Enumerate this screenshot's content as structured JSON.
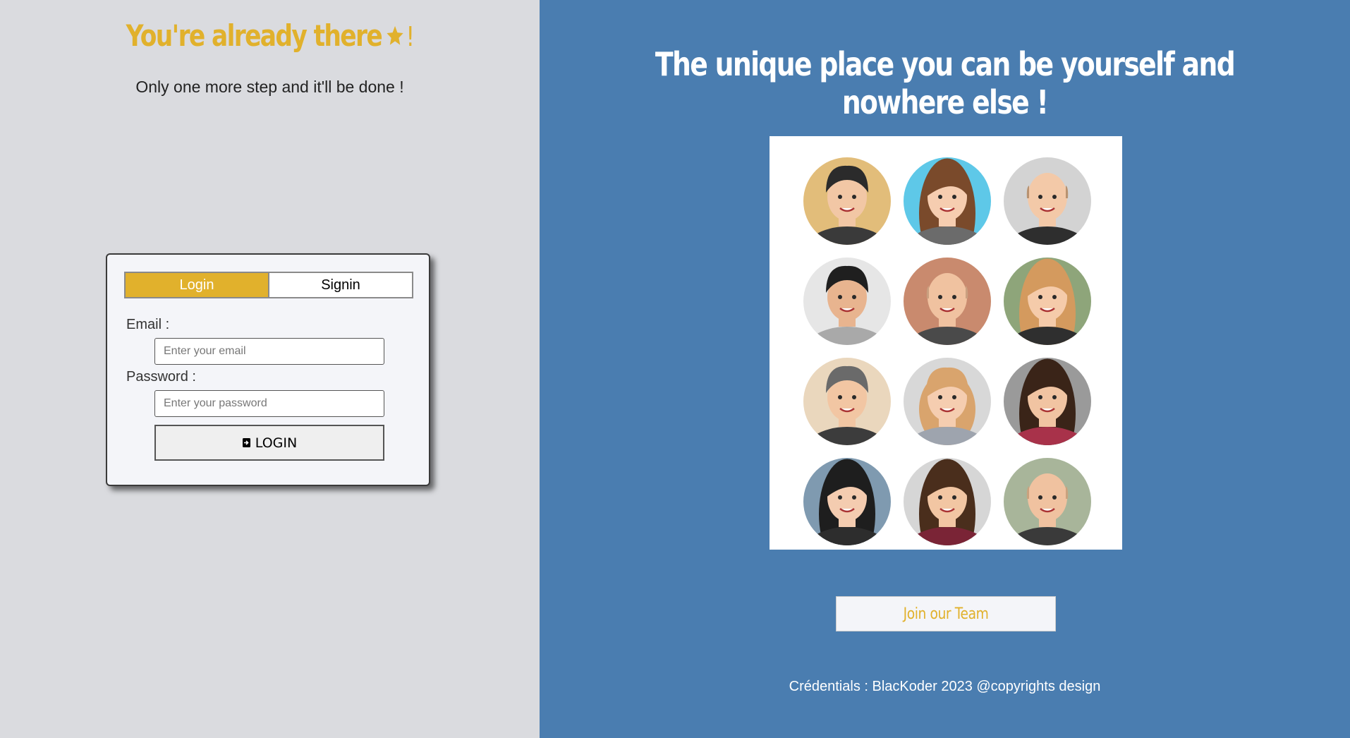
{
  "left": {
    "title": "You're already there",
    "title_excl": "!",
    "subtitle": "Only one more step and it'll be done !"
  },
  "form": {
    "tabs": [
      {
        "label": "Login",
        "active": true
      },
      {
        "label": "Signin",
        "active": false
      }
    ],
    "email_label": "Email :",
    "email_placeholder": "Enter your email",
    "password_label": "Password :",
    "password_placeholder": "Enter your password",
    "submit_label": "LOGIN",
    "submit_icon": "sign-in-icon"
  },
  "right": {
    "title": "The unique place you can be yourself and nowhere else !",
    "image_name": "team-avatars-illustration",
    "join_label": "Join our Team",
    "footer": "Crédentials : BlacKoder 2023 @copyrights design"
  },
  "colors": {
    "accent": "#e1b12c",
    "left_bg": "#dadbdf",
    "right_bg": "#4a7db0",
    "card_bg": "#f4f5f9"
  },
  "avatars": [
    {
      "bg": "#e2bd7a",
      "skin": "#f2c7a5",
      "hair": "#2b2b2b",
      "shirt": "#3a3a3a",
      "style": "short"
    },
    {
      "bg": "#5ec8e8",
      "skin": "#f6cdb0",
      "hair": "#7a4a2b",
      "shirt": "#6b6b6b",
      "style": "long"
    },
    {
      "bg": "#d3d3d3",
      "skin": "#f3c9a8",
      "hair": "#b89270",
      "shirt": "#2e2e2e",
      "style": "bald"
    },
    {
      "bg": "#e6e6e6",
      "skin": "#e8b48f",
      "hair": "#1f1f1f",
      "shirt": "#a9a9a9",
      "style": "spiky"
    },
    {
      "bg": "#c98a6e",
      "skin": "#f0c2a0",
      "hair": "#caa080",
      "shirt": "#4a4a4a",
      "style": "bald"
    },
    {
      "bg": "#8ea57a",
      "skin": "#f5cbaa",
      "hair": "#d49a5e",
      "shirt": "#2f2f2f",
      "style": "long"
    },
    {
      "bg": "#ead7bd",
      "skin": "#f2c6a3",
      "hair": "#6a6a6a",
      "shirt": "#3c3c3c",
      "style": "short"
    },
    {
      "bg": "#d8d8d8",
      "skin": "#f5cdb0",
      "hair": "#d9a46d",
      "shirt": "#9ea4ae",
      "style": "bob"
    },
    {
      "bg": "#9a9a9a",
      "skin": "#f1c4a2",
      "hair": "#3a2418",
      "shirt": "#a8324a",
      "style": "long"
    },
    {
      "bg": "#7f9ab0",
      "skin": "#f4ccb0",
      "hair": "#1e1e1e",
      "shirt": "#2d2d2d",
      "style": "long"
    },
    {
      "bg": "#d6d6d6",
      "skin": "#f2c6a3",
      "hair": "#4a2e1c",
      "shirt": "#7a2436",
      "style": "long"
    },
    {
      "bg": "#a8b59a",
      "skin": "#f0c2a0",
      "hair": "#c9a27e",
      "shirt": "#3a3a3a",
      "style": "bald"
    }
  ]
}
